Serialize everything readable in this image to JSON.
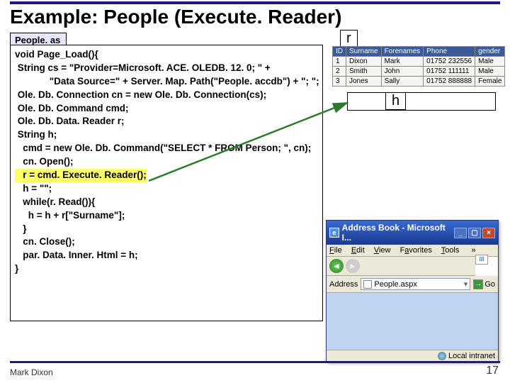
{
  "title": "Example: People (Execute. Reader)",
  "file_label": "People. as px",
  "code_lines": [
    "void Page_Load(){",
    " String cs = \"Provider=Microsoft. ACE. OLEDB. 12. 0; \" +",
    "             \"Data Source=\" + Server. Map. Path(\"People. accdb\") + \"; \";",
    " Ole. Db. Connection cn = new Ole. Db. Connection(cs);",
    " Ole. Db. Command cmd;",
    " Ole. Db. Data. Reader r;",
    " String h;",
    "   cmd = new Ole. Db. Command(\"SELECT * FROM Person; \", cn);",
    "   cn. Open();",
    "   r = cmd. Execute. Reader();",
    "   h = \"\";",
    "   while(r. Read()){",
    "     h = h + r[\"Surname\"];",
    "   }",
    "   cn. Close();",
    "   par. Data. Inner. Html = h;",
    "}"
  ],
  "hl_line_index": 9,
  "var_r": "r",
  "var_h": "h",
  "db": {
    "headers": [
      "ID",
      "Surname",
      "Forenames",
      "Phone",
      "gender"
    ],
    "rows": [
      [
        "1",
        "Dixon",
        "Mark",
        "01752 232556",
        "Male"
      ],
      [
        "2",
        "Smith",
        "John",
        "01752 111111",
        "Male"
      ],
      [
        "3",
        "Jones",
        "Sally",
        "01752 888888",
        "Female"
      ]
    ]
  },
  "browser": {
    "title": "Address Book - Microsoft I...",
    "menu": {
      "file": "File",
      "edit": "Edit",
      "view": "View",
      "fav": "Favorites",
      "tools": "Tools"
    },
    "addr_label": "Address",
    "addr_value": "People.aspx",
    "go": "Go",
    "status": "Local intranet"
  },
  "footer_left": "Mark Dixon",
  "footer_right": "17"
}
